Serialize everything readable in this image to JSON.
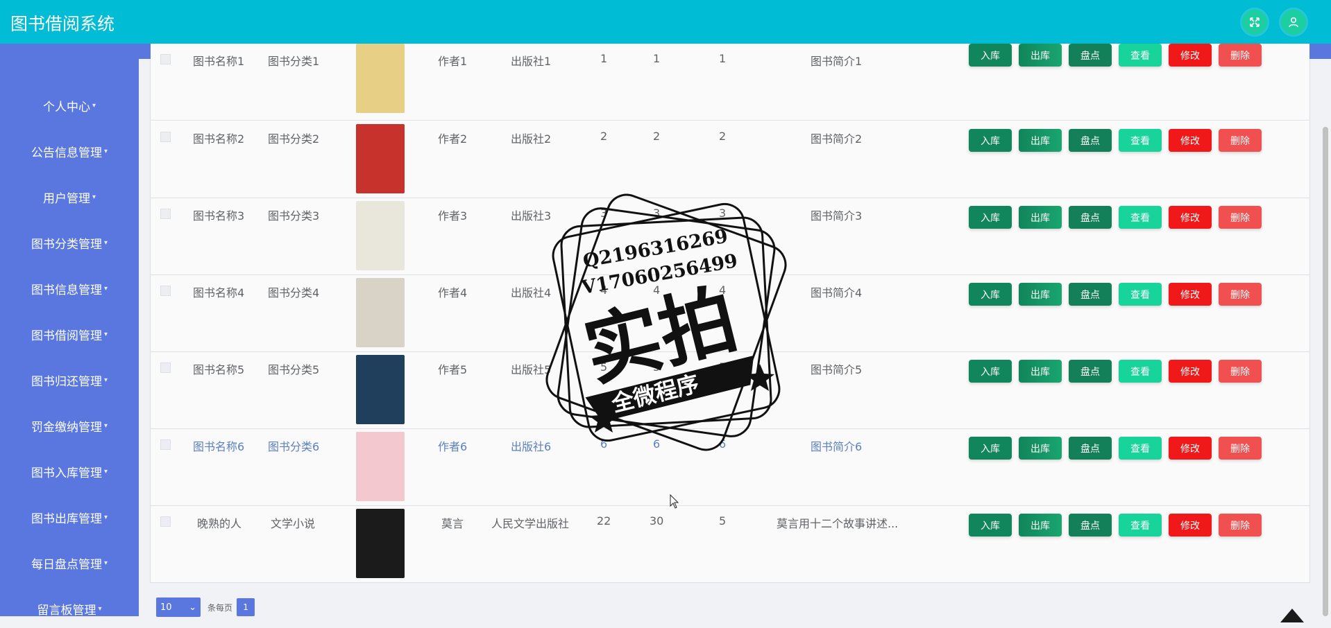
{
  "app": {
    "title": "图书借阅系统"
  },
  "sidebar": {
    "items": [
      {
        "label": "个人中心"
      },
      {
        "label": "公告信息管理"
      },
      {
        "label": "用户管理"
      },
      {
        "label": "图书分类管理"
      },
      {
        "label": "图书信息管理"
      },
      {
        "label": "图书借阅管理"
      },
      {
        "label": "图书归还管理"
      },
      {
        "label": "罚金缴纳管理"
      },
      {
        "label": "图书入库管理"
      },
      {
        "label": "图书出库管理"
      },
      {
        "label": "每日盘点管理"
      },
      {
        "label": "留言板管理"
      }
    ]
  },
  "actions": {
    "in": "入库",
    "out": "出库",
    "check": "盘点",
    "view": "查看",
    "edit": "修改",
    "del": "删除"
  },
  "rows": [
    {
      "name": "图书名称1",
      "category": "图书分类1",
      "author": "作者1",
      "publisher": "出版社1",
      "n1": "1",
      "n2": "1",
      "n3": "1",
      "intro": "图书简介1",
      "cover_color": "#e8cf86"
    },
    {
      "name": "图书名称2",
      "category": "图书分类2",
      "author": "作者2",
      "publisher": "出版社2",
      "n1": "2",
      "n2": "2",
      "n3": "2",
      "intro": "图书简介2",
      "cover_color": "#c7322c"
    },
    {
      "name": "图书名称3",
      "category": "图书分类3",
      "author": "作者3",
      "publisher": "出版社3",
      "n1": "3",
      "n2": "3",
      "n3": "3",
      "intro": "图书简介3",
      "cover_color": "#e9e7dc"
    },
    {
      "name": "图书名称4",
      "category": "图书分类4",
      "author": "作者4",
      "publisher": "出版社4",
      "n1": "4",
      "n2": "4",
      "n3": "4",
      "intro": "图书简介4",
      "cover_color": "#d9d2c6"
    },
    {
      "name": "图书名称5",
      "category": "图书分类5",
      "author": "作者5",
      "publisher": "出版社5",
      "n1": "5",
      "n2": "5",
      "n3": "5",
      "intro": "图书简介5",
      "cover_color": "#1f3f5c"
    },
    {
      "name": "图书名称6",
      "category": "图书分类6",
      "author": "作者6",
      "publisher": "出版社6",
      "n1": "6",
      "n2": "6",
      "n3": "6",
      "intro": "图书简介6",
      "cover_color": "#f3c9cf"
    },
    {
      "name": "晚熟的人",
      "category": "文学小说",
      "author": "莫言",
      "publisher": "人民文学出版社",
      "n1": "22",
      "n2": "30",
      "n3": "5",
      "intro": "莫言用十二个故事讲述...",
      "cover_color": "#1b1b1b"
    }
  ],
  "pagination": {
    "page_size": "10",
    "per_page_label": "条每页",
    "current_page": "1"
  },
  "stamp": {
    "line1": "Q2196316269",
    "line2": "V17060256499",
    "big": "实拍",
    "banner": "全微程序"
  }
}
